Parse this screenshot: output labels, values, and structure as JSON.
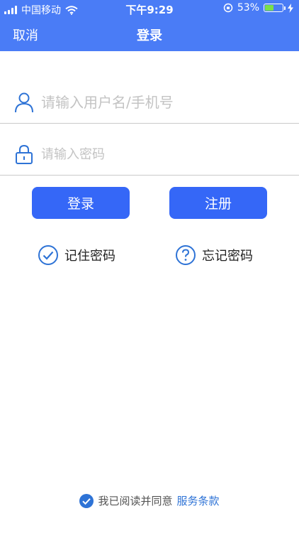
{
  "status_bar": {
    "carrier": "中国移动",
    "time": "下午9:29",
    "battery": "53%",
    "battery_level": 0.53
  },
  "nav": {
    "cancel_label": "取消",
    "title": "登录"
  },
  "form": {
    "username_placeholder": "请输入用户名/手机号",
    "username_value": "",
    "password_placeholder": "请输入密码",
    "password_value": ""
  },
  "buttons": {
    "login_label": "登录",
    "register_label": "注册"
  },
  "options": {
    "remember_label": "记住密码",
    "forgot_label": "忘记密码"
  },
  "agreement": {
    "text": "我已阅读并同意",
    "link": "服务条款"
  },
  "icons": {
    "user": "user-icon",
    "lock": "lock-icon",
    "check": "check-circle-icon",
    "question": "question-circle-icon"
  },
  "colors": {
    "header": "#4a7cf6",
    "button": "#3567f7",
    "icon": "#2e73d6",
    "link": "#2e73d6"
  }
}
